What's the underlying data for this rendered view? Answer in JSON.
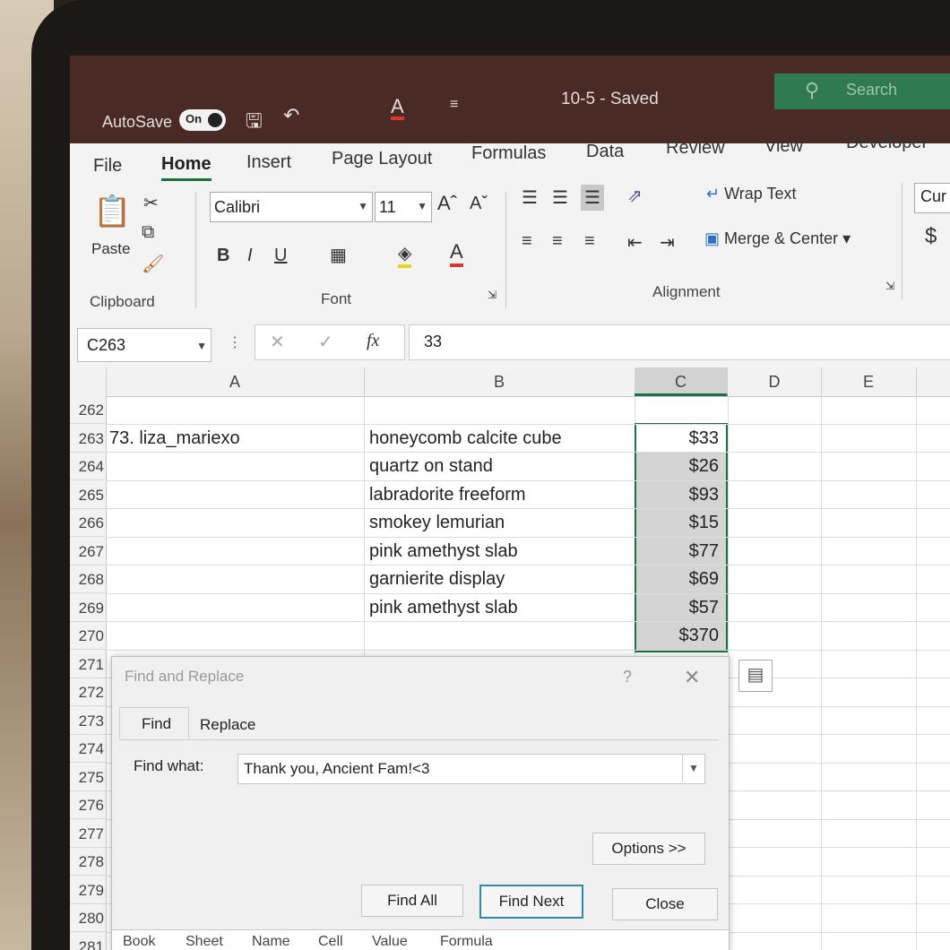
{
  "titlebar": {
    "autosave_label": "AutoSave",
    "autosave_state": "On",
    "doc_title": "10-5 - Saved",
    "search_label": "Search"
  },
  "tabs": [
    "File",
    "Home",
    "Insert",
    "Page Layout",
    "Formulas",
    "Data",
    "Review",
    "View",
    "Developer"
  ],
  "ribbon": {
    "paste_label": "Paste",
    "clipboard_label": "Clipboard",
    "font_name": "Calibri",
    "font_size": "11",
    "font_label": "Font",
    "bold": "B",
    "italic": "I",
    "underline": "U",
    "alignment_label": "Alignment",
    "wrap_text": "Wrap Text",
    "merge_center": "Merge & Center",
    "number_format": "Cur",
    "currency_symbol": "$"
  },
  "formula_bar": {
    "name_box": "C263",
    "fx": "fx",
    "value": "33"
  },
  "columns": [
    "A",
    "B",
    "C",
    "D",
    "E"
  ],
  "rows": [
    {
      "num": "262",
      "a": "",
      "b": "",
      "c": ""
    },
    {
      "num": "263",
      "a": "73. liza_mariexo",
      "b": "honeycomb calcite cube",
      "c": "$33"
    },
    {
      "num": "264",
      "a": "",
      "b": "quartz on stand",
      "c": "$26"
    },
    {
      "num": "265",
      "a": "",
      "b": "labradorite freeform",
      "c": "$93"
    },
    {
      "num": "266",
      "a": "",
      "b": "smokey lemurian",
      "c": "$15"
    },
    {
      "num": "267",
      "a": "",
      "b": "pink amethyst slab",
      "c": "$77"
    },
    {
      "num": "268",
      "a": "",
      "b": "garnierite display",
      "c": "$69"
    },
    {
      "num": "269",
      "a": "",
      "b": "pink amethyst slab",
      "c": "$57"
    },
    {
      "num": "270",
      "a": "",
      "b": "",
      "c": "$370"
    },
    {
      "num": "271",
      "a": "",
      "b": "",
      "c": ""
    },
    {
      "num": "272",
      "a": "",
      "b": "",
      "c": ""
    },
    {
      "num": "273",
      "a": "",
      "b": "",
      "c": ""
    },
    {
      "num": "274",
      "a": "",
      "b": "",
      "c": ""
    },
    {
      "num": "275",
      "a": "",
      "b": "",
      "c": ""
    },
    {
      "num": "276",
      "a": "",
      "b": "",
      "c": ""
    },
    {
      "num": "277",
      "a": "",
      "b": "",
      "c": ""
    },
    {
      "num": "278",
      "a": "",
      "b": "",
      "c": ""
    },
    {
      "num": "279",
      "a": "",
      "b": "",
      "c": ""
    },
    {
      "num": "280",
      "a": "",
      "b": "",
      "c": ""
    },
    {
      "num": "281",
      "a": "",
      "b": "",
      "c": ""
    }
  ],
  "dialog": {
    "title": "Find and Replace",
    "help": "?",
    "tab_find": "Find",
    "tab_replace": "Replace",
    "find_what_label": "Find what:",
    "find_what_value": "Thank you, Ancient Fam!<3",
    "options": "Options >>",
    "find_all": "Find All",
    "find_next": "Find Next",
    "close": "Close",
    "result_columns": [
      "Book",
      "Sheet",
      "Name",
      "Cell",
      "Value",
      "Formula"
    ]
  },
  "colors": {
    "titlebar": "#4a2a24",
    "search": "#2f7a50",
    "selection_border": "#1e6e4a"
  }
}
